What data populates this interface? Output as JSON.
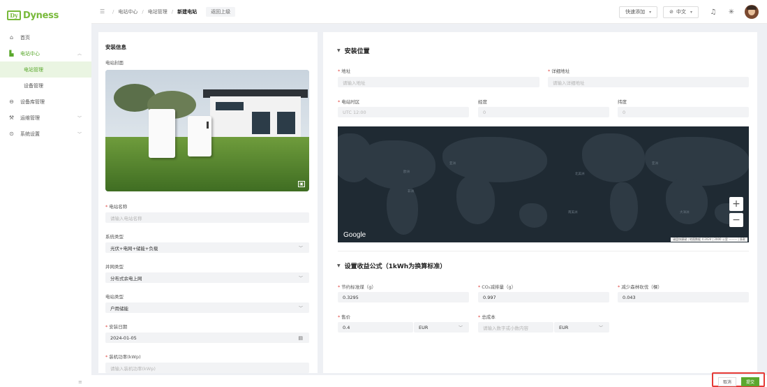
{
  "brand": {
    "mark": "Dy",
    "name": "Dyness"
  },
  "sidebar": {
    "items": [
      {
        "label": "首页",
        "icon": "home-icon"
      },
      {
        "label": "电站中心",
        "icon": "station-icon",
        "expanded": true
      },
      {
        "label": "电站管理",
        "sub": true,
        "selected": true
      },
      {
        "label": "设备管理",
        "sub": true
      },
      {
        "label": "设备库管理",
        "icon": "database-icon"
      },
      {
        "label": "运维管理",
        "icon": "tools-icon"
      },
      {
        "label": "系统设置",
        "icon": "settings-icon"
      }
    ],
    "collapse_icon": "≡"
  },
  "topbar": {
    "breadcrumbs": [
      "电站中心",
      "电站管理",
      "新建电站"
    ],
    "back_label": "返回上级",
    "quick_add_label": "快速添加",
    "language_label": "中文",
    "theme_icon": "sun-icon",
    "bell_icon": "bell-icon"
  },
  "install_info": {
    "title": "安装信息",
    "cover_label": "电站封面",
    "station_name_label": "电站名称",
    "station_name_placeholder": "请输入电站名称",
    "system_type_label": "系统类型",
    "system_type_value": "光伏+电网+储能+负载",
    "grid_type_label": "并网类型",
    "grid_type_value": "分布式余电上网",
    "station_type_label": "电站类型",
    "station_type_value": "户用储能",
    "install_date_label": "安装日期",
    "install_date_value": "2024-01-05",
    "capacity_label": "装机功率(kWp)",
    "capacity_placeholder": "请输入装机功率(kWp)"
  },
  "location": {
    "title": "安装位置",
    "address_label": "地址",
    "address_placeholder": "请输入地址",
    "detail_label": "详细地址",
    "detail_placeholder": "请输入详细地址",
    "timezone_label": "电站时区",
    "timezone_value": "UTC 12:00",
    "longitude_label": "经度",
    "longitude_value": "0",
    "latitude_label": "纬度",
    "latitude_value": "0",
    "map": {
      "provider": "Google",
      "zoom_in": "+",
      "zoom_out": "−",
      "attribution": "键盘快捷键 | 地图数据 ©2024 | 2000 公里 ——— | 条款"
    }
  },
  "revenue": {
    "title": "设置收益公式（1kWh为换算标准）",
    "coal_label": "节约标准煤（g）",
    "coal_value": "0.3295",
    "co2_label": "CO₂减排量（g）",
    "co2_value": "0.997",
    "trees_label": "减少森林砍伐（棵）",
    "trees_value": "0.043",
    "price_label": "售价",
    "price_value": "0.4",
    "price_currency": "EUR",
    "cost_label": "总成本",
    "cost_placeholder": "请输入数字或小数内容",
    "cost_currency": "EUR"
  },
  "actions": {
    "cancel_label": "取消",
    "submit_label": "提交"
  },
  "colors": {
    "accent": "#5aa82d",
    "required": "#e0443e",
    "highlight": "#e53935"
  }
}
